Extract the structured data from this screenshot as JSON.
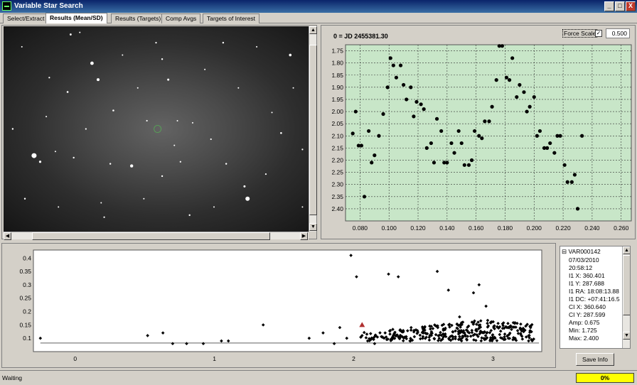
{
  "window": {
    "title": "Variable Star Search",
    "minimize": "_",
    "maximize": "□",
    "close": "X"
  },
  "tabs": [
    {
      "label": "Select/Extract"
    },
    {
      "label": "Results (Mean/SD)"
    },
    {
      "label": "Results (Targets)"
    },
    {
      "label": "Comp Avgs"
    },
    {
      "label": "Targets of Interest"
    }
  ],
  "image_view": {
    "stars": [
      [
        0.52,
        0.16,
        1.2
      ],
      [
        0.29,
        0.18,
        2.4
      ],
      [
        0.31,
        0.26,
        2.0
      ],
      [
        0.22,
        0.04,
        1.4
      ],
      [
        0.25,
        0.03,
        1.0
      ],
      [
        0.1,
        0.63,
        3.5
      ],
      [
        0.12,
        0.66,
        1.6
      ],
      [
        0.23,
        0.64,
        1.2
      ],
      [
        0.15,
        0.25,
        1.1
      ],
      [
        0.17,
        0.61,
        1.0
      ],
      [
        0.42,
        0.68,
        2.2
      ],
      [
        0.52,
        0.73,
        1.2
      ],
      [
        0.8,
        0.84,
        3.0
      ],
      [
        0.79,
        0.78,
        1.5
      ],
      [
        0.54,
        0.26,
        1.5
      ],
      [
        0.72,
        0.08,
        1.2
      ],
      [
        0.83,
        0.1,
        1.0
      ],
      [
        0.94,
        0.14,
        1.8
      ],
      [
        0.57,
        0.46,
        1.0
      ],
      [
        0.62,
        0.47,
        1.0
      ],
      [
        0.68,
        0.55,
        1.1
      ],
      [
        0.36,
        0.41,
        1.3
      ],
      [
        0.5,
        0.08,
        1.1
      ],
      [
        0.06,
        0.1,
        1.0
      ],
      [
        0.03,
        0.5,
        1.2
      ],
      [
        0.98,
        0.6,
        1.1
      ],
      [
        0.35,
        0.67,
        1.2
      ],
      [
        0.88,
        0.42,
        1.0
      ],
      [
        0.91,
        0.52,
        1.3
      ],
      [
        0.77,
        0.3,
        1.0
      ],
      [
        0.61,
        0.92,
        1.2
      ],
      [
        0.46,
        0.84,
        1.0
      ],
      [
        0.33,
        0.93,
        1.1
      ],
      [
        0.18,
        0.88,
        1.0
      ],
      [
        0.07,
        0.84,
        1.2
      ],
      [
        0.44,
        0.3,
        1.0
      ],
      [
        0.66,
        0.21,
        1.0
      ],
      [
        0.73,
        0.67,
        1.2
      ],
      [
        0.86,
        0.72,
        1.1
      ],
      [
        0.95,
        0.3,
        1.0
      ],
      [
        0.39,
        0.14,
        1.0
      ],
      [
        0.47,
        0.46,
        1.1
      ],
      [
        0.56,
        0.58,
        1.0
      ],
      [
        0.27,
        0.5,
        1.1
      ],
      [
        0.14,
        0.44,
        1.0
      ],
      [
        0.21,
        0.32,
        1.3
      ],
      [
        0.32,
        0.86,
        1.0
      ],
      [
        0.58,
        0.66,
        1.1
      ],
      [
        0.69,
        0.88,
        1.0
      ],
      [
        0.98,
        0.88,
        1.0
      ]
    ]
  },
  "lightcurve": {
    "header": "0 = JD 2455381.30",
    "force_scale_label": "Force Scale",
    "force_scale_checked": "✓",
    "force_scale_value": "0.500",
    "bg_color": "#c8e6c8"
  },
  "scatter": {},
  "tree": {
    "root": "VAR000142",
    "items": [
      "07/03/2010",
      "20:58:12",
      "I1 X: 360.401",
      "I1 Y: 287.688",
      "I1 RA: 18:08:13.88",
      "I1 DC: +07:41:16.5",
      "CI X: 360.640",
      "CI Y: 287.599",
      "Amp: 0.675",
      "Min: 1.725",
      "Max: 2.400"
    ]
  },
  "save_info_label": "Save Info",
  "status": {
    "text": "Waiting",
    "progress": "0%"
  },
  "chart_data": [
    {
      "type": "scatter",
      "title": "",
      "xlabel": "",
      "ylabel": "",
      "xlim": [
        0.07,
        0.267
      ],
      "ylim": [
        1.725,
        2.45
      ],
      "y_inverted": true,
      "grid": true,
      "x_ticks": [
        "0.080",
        "0.100",
        "0.120",
        "0.140",
        "0.160",
        "0.180",
        "0.200",
        "0.220",
        "0.240",
        "0.260"
      ],
      "y_ticks": [
        "1.75",
        "1.80",
        "1.85",
        "1.90",
        "1.95",
        "2.00",
        "2.05",
        "2.10",
        "2.15",
        "2.20",
        "2.25",
        "2.30",
        "2.35",
        "2.40"
      ],
      "points": [
        [
          0.075,
          2.09
        ],
        [
          0.077,
          2.0
        ],
        [
          0.079,
          2.14
        ],
        [
          0.081,
          2.14
        ],
        [
          0.083,
          2.35
        ],
        [
          0.086,
          2.08
        ],
        [
          0.088,
          2.21
        ],
        [
          0.09,
          2.18
        ],
        [
          0.093,
          2.1
        ],
        [
          0.096,
          2.01
        ],
        [
          0.099,
          1.9
        ],
        [
          0.101,
          1.78
        ],
        [
          0.103,
          1.81
        ],
        [
          0.105,
          1.86
        ],
        [
          0.108,
          1.81
        ],
        [
          0.11,
          1.89
        ],
        [
          0.112,
          1.95
        ],
        [
          0.115,
          1.9
        ],
        [
          0.117,
          2.02
        ],
        [
          0.119,
          1.96
        ],
        [
          0.122,
          1.97
        ],
        [
          0.124,
          1.99
        ],
        [
          0.126,
          2.15
        ],
        [
          0.129,
          2.13
        ],
        [
          0.131,
          2.21
        ],
        [
          0.133,
          2.03
        ],
        [
          0.136,
          2.08
        ],
        [
          0.138,
          2.21
        ],
        [
          0.14,
          2.21
        ],
        [
          0.143,
          2.13
        ],
        [
          0.145,
          2.17
        ],
        [
          0.148,
          2.08
        ],
        [
          0.15,
          2.13
        ],
        [
          0.152,
          2.22
        ],
        [
          0.155,
          2.22
        ],
        [
          0.157,
          2.2
        ],
        [
          0.159,
          2.08
        ],
        [
          0.162,
          2.1
        ],
        [
          0.164,
          2.11
        ],
        [
          0.166,
          2.04
        ],
        [
          0.169,
          2.04
        ],
        [
          0.171,
          1.98
        ],
        [
          0.174,
          1.87
        ],
        [
          0.176,
          1.73
        ],
        [
          0.178,
          1.73
        ],
        [
          0.181,
          1.86
        ],
        [
          0.183,
          1.87
        ],
        [
          0.185,
          1.78
        ],
        [
          0.188,
          1.94
        ],
        [
          0.19,
          1.89
        ],
        [
          0.193,
          1.92
        ],
        [
          0.195,
          2.0
        ],
        [
          0.197,
          1.98
        ],
        [
          0.2,
          1.94
        ],
        [
          0.202,
          2.1
        ],
        [
          0.204,
          2.08
        ],
        [
          0.207,
          2.15
        ],
        [
          0.209,
          2.15
        ],
        [
          0.211,
          2.13
        ],
        [
          0.214,
          2.17
        ],
        [
          0.216,
          2.1
        ],
        [
          0.218,
          2.1
        ],
        [
          0.221,
          2.22
        ],
        [
          0.223,
          2.29
        ],
        [
          0.226,
          2.29
        ],
        [
          0.228,
          2.26
        ],
        [
          0.23,
          2.4
        ],
        [
          0.233,
          2.1
        ]
      ]
    },
    {
      "type": "scatter",
      "title": "",
      "xlabel": "",
      "ylabel": "",
      "xlim": [
        -0.3,
        3.35
      ],
      "ylim": [
        0.05,
        0.43
      ],
      "grid": false,
      "x_ticks": [
        "0",
        "1",
        "2",
        "3"
      ],
      "y_ticks": [
        "0.1",
        "0.15",
        "0.2",
        "0.25",
        "0.3",
        "0.35",
        "0.4"
      ],
      "highlight": [
        2.06,
        0.15
      ],
      "points": [
        [
          -0.25,
          0.1
        ],
        [
          0.52,
          0.11
        ],
        [
          0.63,
          0.12
        ],
        [
          0.7,
          0.08
        ],
        [
          0.8,
          0.08
        ],
        [
          0.92,
          0.08
        ],
        [
          1.05,
          0.09
        ],
        [
          1.1,
          0.09
        ],
        [
          1.35,
          0.15
        ],
        [
          1.68,
          0.1
        ],
        [
          1.78,
          0.12
        ],
        [
          1.86,
          0.08
        ],
        [
          1.9,
          0.14
        ],
        [
          1.95,
          0.1
        ],
        [
          1.98,
          0.41
        ],
        [
          2.02,
          0.33
        ],
        [
          2.06,
          0.11
        ],
        [
          2.1,
          0.09
        ],
        [
          2.15,
          0.08
        ],
        [
          2.25,
          0.34
        ],
        [
          2.32,
          0.33
        ],
        [
          2.5,
          0.12
        ],
        [
          2.6,
          0.35
        ],
        [
          2.68,
          0.28
        ],
        [
          2.76,
          0.18
        ],
        [
          2.86,
          0.27
        ],
        [
          2.9,
          0.3
        ],
        [
          2.95,
          0.22
        ]
      ]
    }
  ]
}
